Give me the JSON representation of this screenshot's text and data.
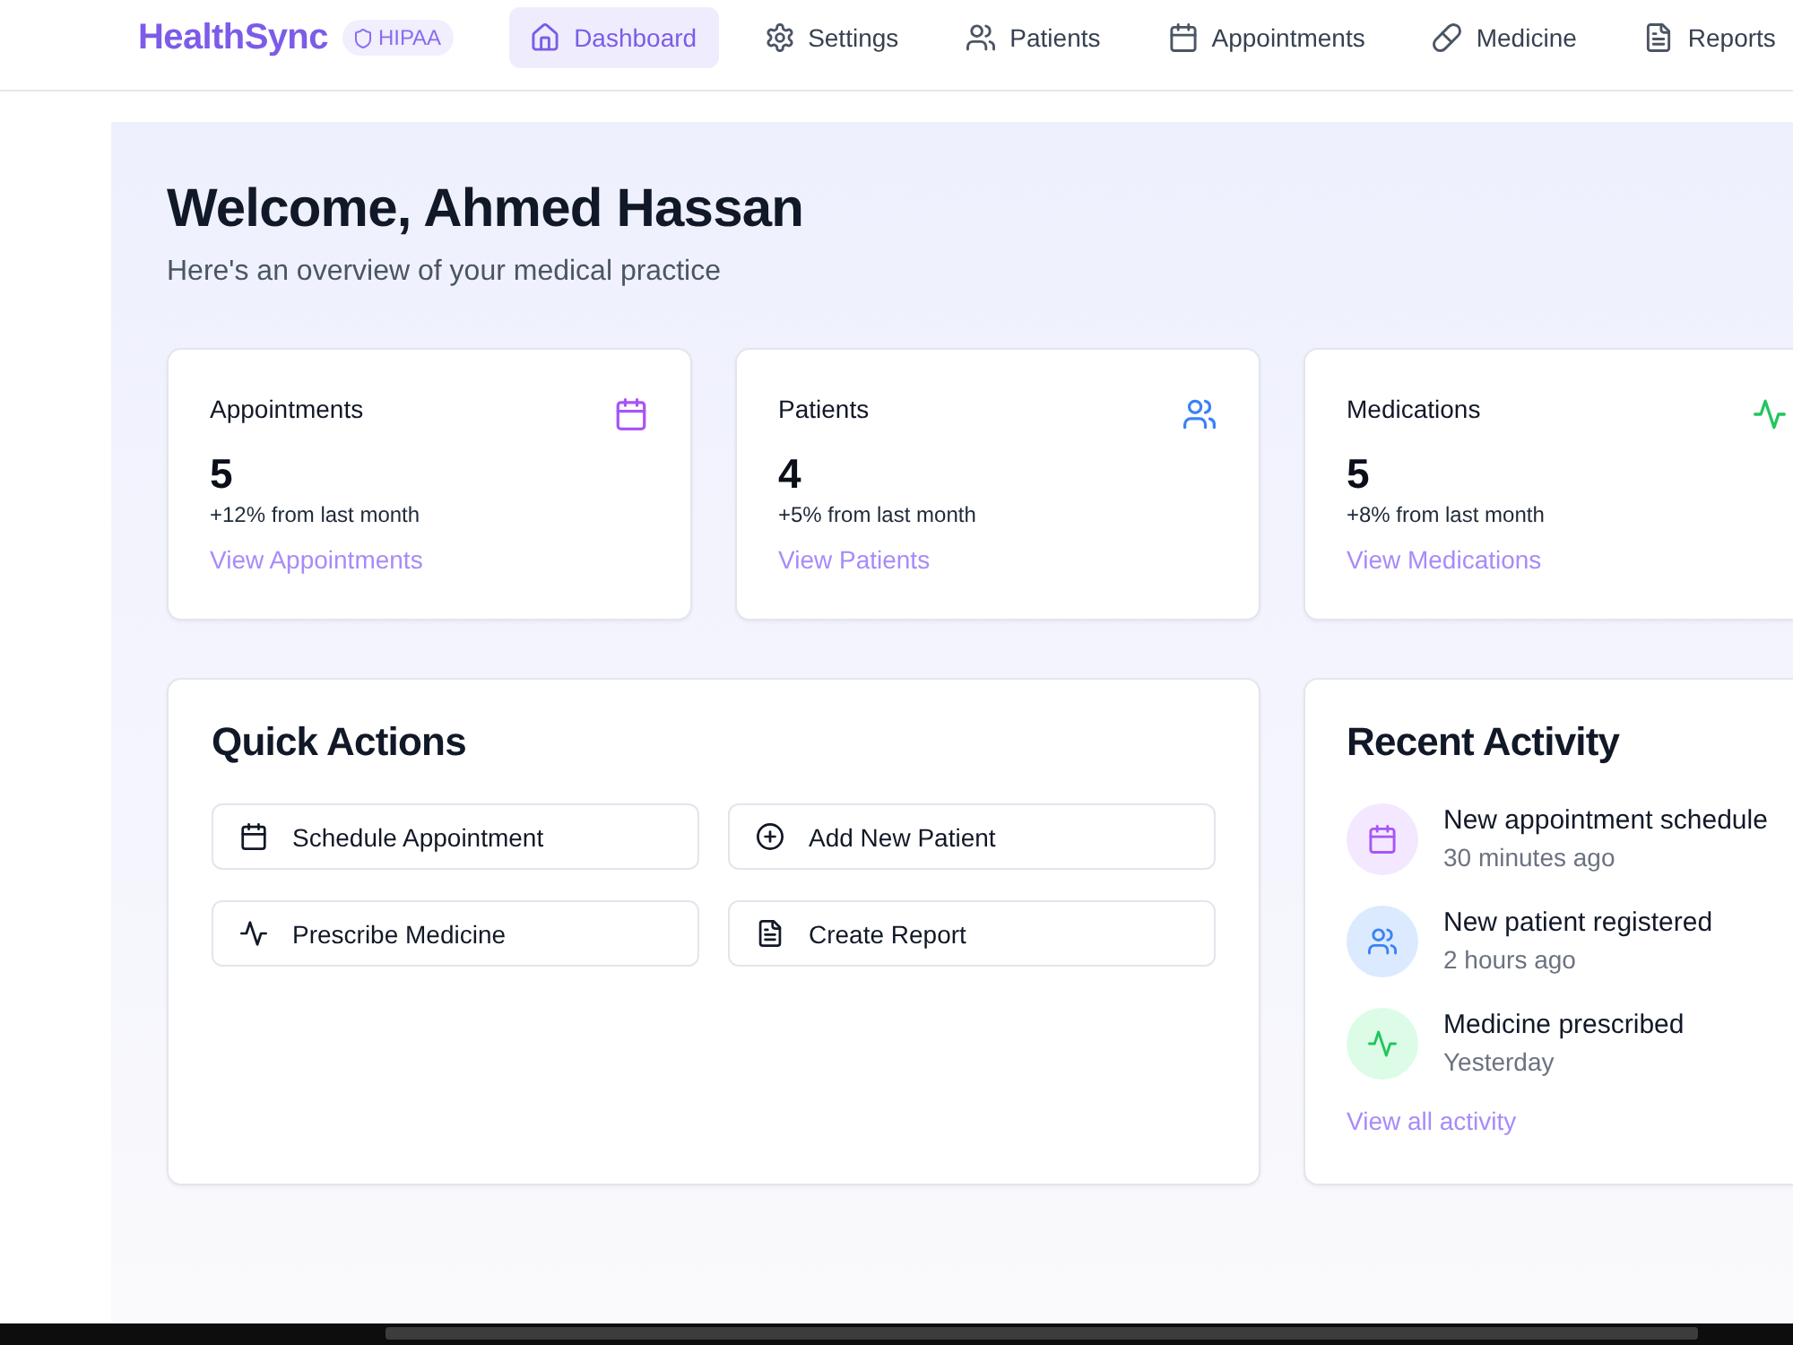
{
  "header": {
    "logo": "HealthSync",
    "badge": "HIPAA",
    "nav": [
      {
        "label": "Dashboard",
        "kind": "home",
        "selected": true
      },
      {
        "label": "Settings",
        "kind": "settings",
        "selected": false
      },
      {
        "label": "Patients",
        "kind": "users",
        "selected": false
      },
      {
        "label": "Appointments",
        "kind": "calendar",
        "selected": false
      },
      {
        "label": "Medicine",
        "kind": "pill",
        "selected": false
      },
      {
        "label": "Reports",
        "kind": "document",
        "selected": false
      }
    ]
  },
  "welcome": {
    "title": "Welcome, Ahmed Hassan",
    "subtitle": "Here's an overview of your medical practice"
  },
  "stats": [
    {
      "label": "Appointments",
      "kind": "calendar",
      "value": "5",
      "change": "+12% from last month",
      "link": "View Appointments"
    },
    {
      "label": "Patients",
      "kind": "users",
      "value": "4",
      "change": "+5% from last month",
      "link": "View Patients"
    },
    {
      "label": "Medications",
      "kind": "pulse",
      "value": "5",
      "change": "+8% from last month",
      "link": "View Medications"
    }
  ],
  "quick_actions": {
    "title": "Quick Actions",
    "actions": [
      {
        "label": "Schedule Appointment",
        "kind": "calendar"
      },
      {
        "label": "Add New Patient",
        "kind": "plus"
      },
      {
        "label": "Prescribe Medicine",
        "kind": "pulse"
      },
      {
        "label": "Create Report",
        "kind": "document"
      }
    ]
  },
  "recent_activity": {
    "title": "Recent Activity",
    "items": [
      {
        "title": "New appointment schedule",
        "time": "30 minutes ago",
        "kind": "calendar"
      },
      {
        "title": "New patient registered",
        "time": "2 hours ago",
        "kind": "users"
      },
      {
        "title": "Medicine prescribed",
        "time": "Yesterday",
        "kind": "pulse"
      }
    ],
    "link": "View all activity"
  }
}
